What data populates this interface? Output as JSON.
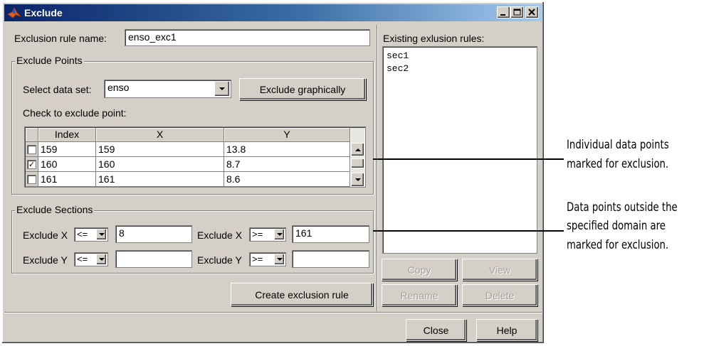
{
  "window": {
    "title": "Exclude",
    "controls": [
      "minimize",
      "maximize",
      "close"
    ]
  },
  "rule_name": {
    "label": "Exclusion rule name:",
    "value": "enso_exc1"
  },
  "exclude_points": {
    "group_label": "Exclude Points",
    "dataset_label": "Select data set:",
    "dataset_value": "enso",
    "exclude_graphically_label": "Exclude graphically",
    "check_label": "Check to exclude point:",
    "table": {
      "columns": [
        "Index",
        "X",
        "Y"
      ],
      "rows": [
        {
          "checked": false,
          "index": "159",
          "x": "159",
          "y": "13.8"
        },
        {
          "checked": true,
          "index": "160",
          "x": "160",
          "y": "8.7"
        },
        {
          "checked": false,
          "index": "161",
          "x": "161",
          "y": "8.6"
        }
      ]
    }
  },
  "exclude_sections": {
    "group_label": "Exclude Sections",
    "x_low": {
      "label": "Exclude X",
      "op": "<=",
      "value": "8"
    },
    "x_high": {
      "label": "Exclude X",
      "op": ">=",
      "value": "161"
    },
    "y_low": {
      "label": "Exclude Y",
      "op": "<=",
      "value": ""
    },
    "y_high": {
      "label": "Exclude Y",
      "op": ">=",
      "value": ""
    }
  },
  "create_button": "Create exclusion rule",
  "existing": {
    "label": "Existing exlusion rules:",
    "items": [
      "sec1",
      "sec2"
    ]
  },
  "rule_buttons": {
    "copy": "Copy",
    "view": "View",
    "rename": "Rename",
    "delete": "Delete"
  },
  "footer": {
    "close": "Close",
    "help": "Help"
  },
  "annotations": {
    "points_line1": "Individual data points",
    "points_line2": "marked for exclusion.",
    "domain_line1": "Data points outside the",
    "domain_line2": "specified domain are",
    "domain_line3": "marked for exclusion."
  },
  "colors": {
    "title_bar_start": "#0a246a",
    "title_bar_end": "#a6caf0",
    "window_face": "#d4d0c8",
    "disabled_text": "#a0a0a0"
  }
}
